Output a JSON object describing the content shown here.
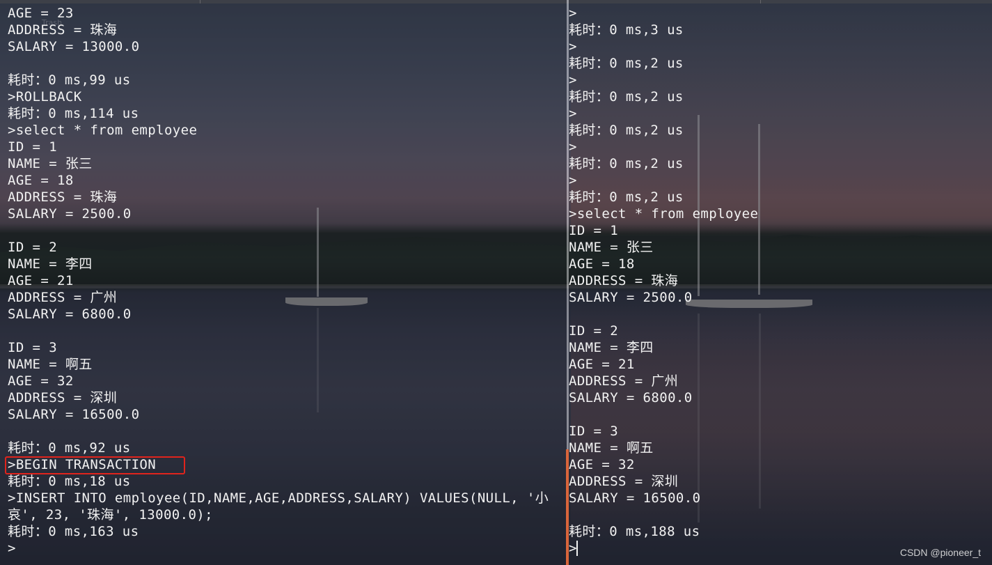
{
  "left_terminal": {
    "lines": [
      "AGE = 23",
      "ADDRESS = 珠海",
      "SALARY = 13000.0",
      "",
      "耗时：0 ms,99 us",
      ">ROLLBACK",
      "耗时：0 ms,114 us",
      ">select * from employee",
      "ID = 1",
      "NAME = 张三",
      "AGE = 18",
      "ADDRESS = 珠海",
      "SALARY = 2500.0",
      "",
      "ID = 2",
      "NAME = 李四",
      "AGE = 21",
      "ADDRESS = 广州",
      "SALARY = 6800.0",
      "",
      "ID = 3",
      "NAME = 啊五",
      "AGE = 32",
      "ADDRESS = 深圳",
      "SALARY = 16500.0",
      "",
      "耗时：0 ms,92 us",
      ">BEGIN TRANSACTION",
      "耗时：0 ms,18 us",
      ">INSERT INTO employee(ID,NAME,AGE,ADDRESS,SALARY) VALUES(NULL, '小",
      "哀', 23, '珠海', 13000.0);",
      "耗时：0 ms,163 us",
      ">"
    ],
    "highlighted_command": ">BEGIN TRANSACTION"
  },
  "right_terminal": {
    "lines": [
      ">",
      "耗时：0 ms,3 us",
      ">",
      "耗时：0 ms,2 us",
      ">",
      "耗时：0 ms,2 us",
      ">",
      "耗时：0 ms,2 us",
      ">",
      "耗时：0 ms,2 us",
      ">",
      "耗时：0 ms,2 us",
      ">select * from employee",
      "ID = 1",
      "NAME = 张三",
      "AGE = 18",
      "ADDRESS = 珠海",
      "SALARY = 2500.0",
      "",
      "ID = 2",
      "NAME = 李四",
      "AGE = 21",
      "ADDRESS = 广州",
      "SALARY = 6800.0",
      "",
      "ID = 3",
      "NAME = 啊五",
      "AGE = 32",
      "ADDRESS = 深圳",
      "SALARY = 16500.0",
      "",
      "耗时：0 ms,188 us",
      ">"
    ]
  },
  "desktop_ghost_label": "Trash",
  "watermark": "CSDN @pioneer_t",
  "colors": {
    "terminal_text": "#f2f2f2",
    "highlight_box": "#e0241c",
    "divider_accent": "#d9653b"
  }
}
